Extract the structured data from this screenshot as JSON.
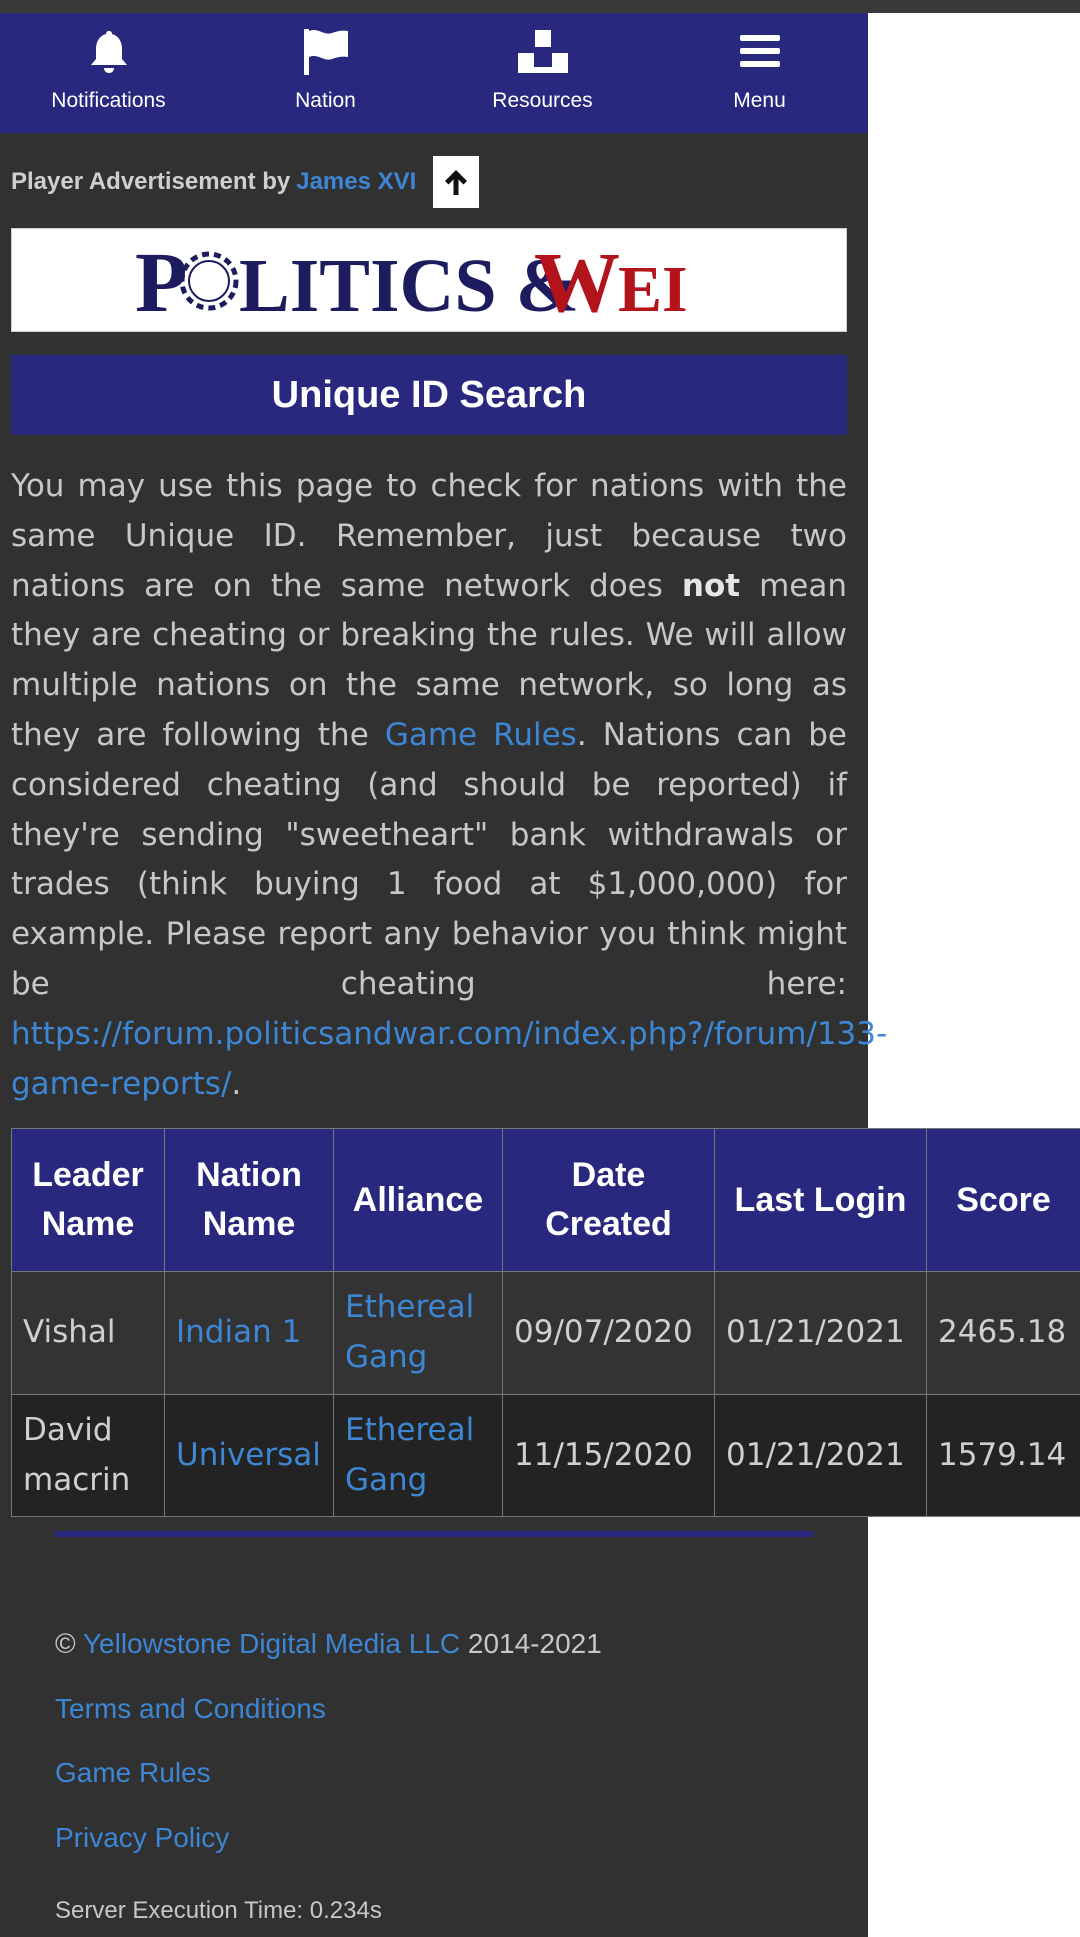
{
  "nav": {
    "items": [
      {
        "label": "Notifications",
        "icon": "bell-icon"
      },
      {
        "label": "Nation",
        "icon": "flag-icon"
      },
      {
        "label": "Resources",
        "icon": "resources-icon"
      },
      {
        "label": "Menu",
        "icon": "menu-icon"
      }
    ],
    "background": "#28287f"
  },
  "ad": {
    "text": "Player Advertisement by",
    "author": "James XVI",
    "banner_text": "POLITICS & WEI"
  },
  "page_title": "Unique ID Search",
  "intro": {
    "part1": "You may use this page to check for nations with the same Unique ID. Remember, just because two nations are on the same network does ",
    "bold": "not",
    "part2": " mean they are cheating or breaking the rules. We will allow multiple nations on the same network, so long as they are following the ",
    "rules_link": "Game Rules",
    "part3": ". Nations can be considered cheating (and should be reported) if they're sending \"sweetheart\" bank withdrawals or trades (think buying 1 food at $1,000,000) for example. Please report any behavior you think might be cheating here: ",
    "report_link": "https://forum.politicsandwar.com/index.php?/forum/133-game-reports/",
    "part4": "."
  },
  "table": {
    "headers": [
      "Leader Name",
      "Nation Name",
      "Alliance",
      "Date Created",
      "Last Login",
      "Score"
    ],
    "rows": [
      {
        "leader": "Vishal",
        "nation": "Indian 1",
        "alliance": "Ethereal Gang",
        "created": "09/07/2020",
        "last_login": "01/21/2021",
        "score": "2465.18"
      },
      {
        "leader": "David macrin",
        "nation": "Universal",
        "alliance": "Ethereal Gang",
        "created": "11/15/2020",
        "last_login": "01/21/2021",
        "score": "1579.14"
      }
    ]
  },
  "footer": {
    "copyright_symbol": "©",
    "company": "Yellowstone Digital Media LLC",
    "years": "2014-2021",
    "terms": "Terms and Conditions",
    "rules": "Game Rules",
    "privacy": "Privacy Policy",
    "exec_time": "Server Execution Time: 0.234s"
  },
  "colors": {
    "accent": "#28287f",
    "link": "#3d86d3",
    "page_bg": "#313131"
  }
}
